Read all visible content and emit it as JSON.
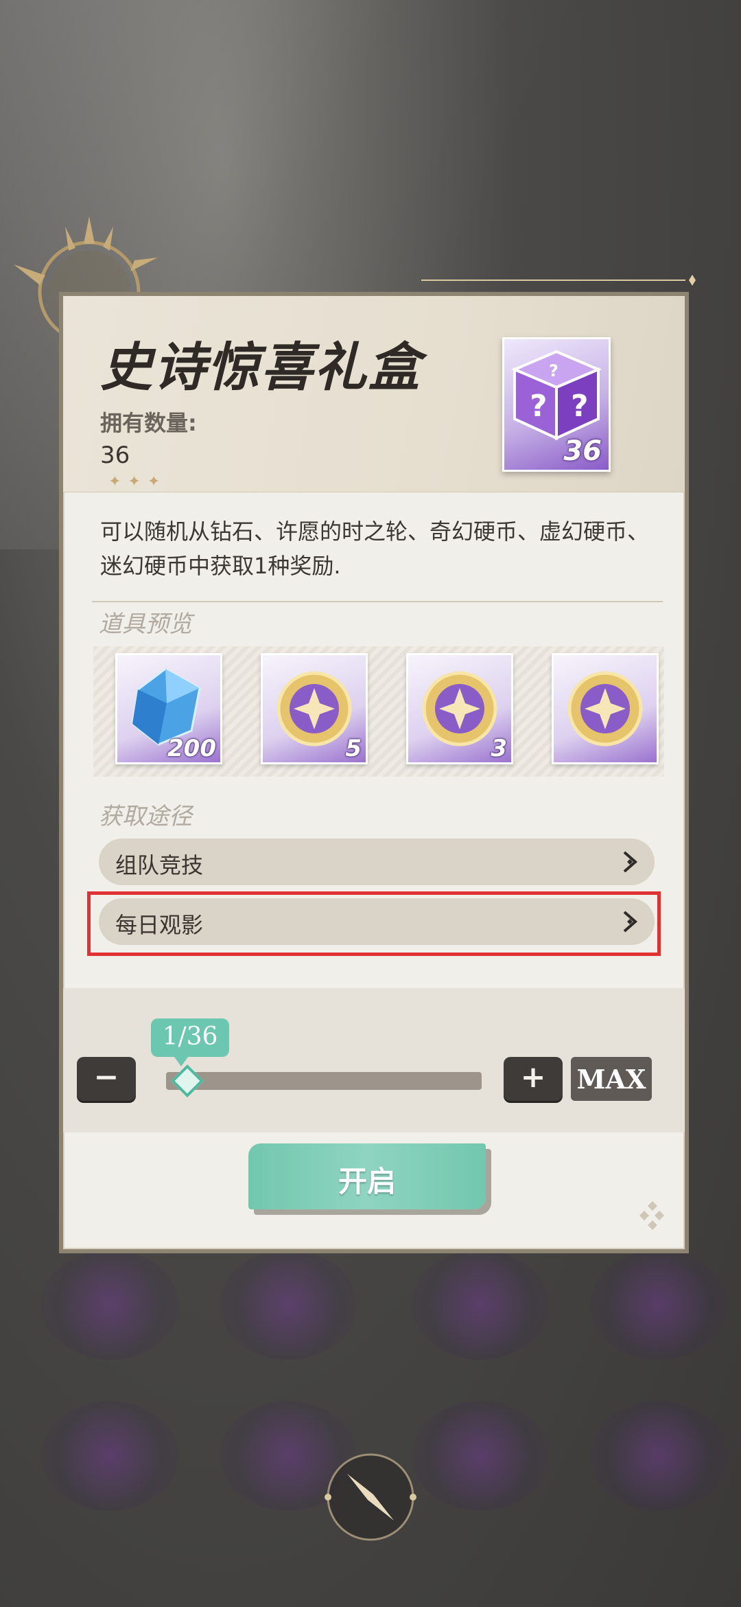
{
  "popup": {
    "title": "史诗惊喜礼盒",
    "own_label": "拥有数量:",
    "own_value": "36",
    "box_count": "36",
    "description": "可以随机从钻石、许愿的时之轮、奇幻硬币、虚幻硬币、迷幻硬币中获取1种奖励.",
    "preview_label": "道具预览",
    "preview_items": [
      {
        "icon": "diamond-icon",
        "qty": "200"
      },
      {
        "icon": "coin-icon",
        "qty": "5"
      },
      {
        "icon": "coin-icon",
        "qty": "3"
      },
      {
        "icon": "coin-icon",
        "qty": ""
      }
    ],
    "source_label": "获取途径",
    "sources": [
      {
        "label": "组队竞技"
      },
      {
        "label": "每日观影"
      }
    ],
    "slider": {
      "value_text": "1/36",
      "current": 1,
      "max": 36,
      "minus_label": "−",
      "plus_label": "+",
      "max_label": "MAX"
    },
    "open_label": "开启"
  },
  "colors": {
    "accent_teal": "#6cc7b1",
    "highlight_red": "#e03232",
    "item_purple": "#9a72cf"
  }
}
